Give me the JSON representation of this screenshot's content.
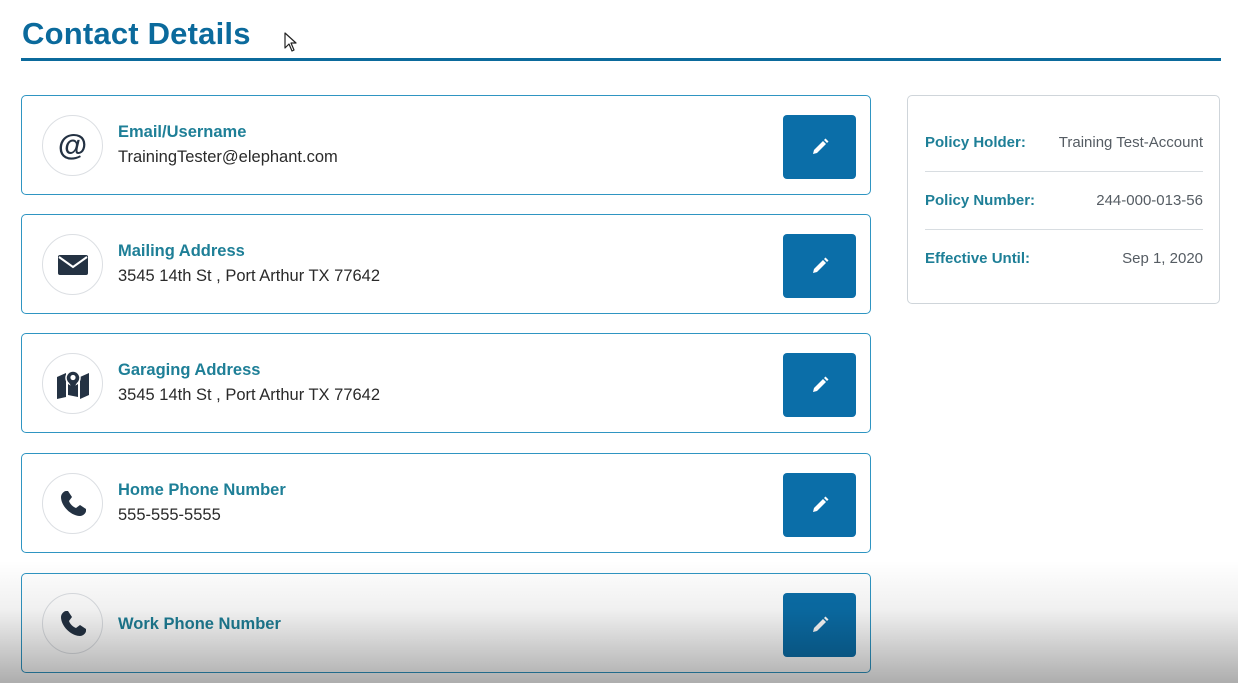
{
  "page": {
    "title": "Contact Details"
  },
  "contacts": [
    {
      "label": "Email/Username",
      "value": "TrainingTester@elephant.com",
      "icon": "at-sign-icon"
    },
    {
      "label": "Mailing Address",
      "value": "3545 14th St , Port Arthur TX 77642",
      "icon": "envelope-icon"
    },
    {
      "label": "Garaging Address",
      "value": "3545 14th St , Port Arthur TX 77642",
      "icon": "map-pin-icon"
    },
    {
      "label": "Home Phone Number",
      "value": "555-555-5555",
      "icon": "phone-icon"
    },
    {
      "label": "Work Phone Number",
      "value": "",
      "icon": "phone-icon"
    }
  ],
  "policy": {
    "holder_label": "Policy Holder:",
    "holder_value": "Training Test-Account",
    "number_label": "Policy Number:",
    "number_value": "244-000-013-56",
    "effective_label": "Effective Until:",
    "effective_value": "Sep 1, 2020"
  },
  "colors": {
    "accent": "#0b6a9c",
    "button": "#0b6ea8",
    "label": "#1e7f97",
    "card_border": "#2f95c2"
  }
}
